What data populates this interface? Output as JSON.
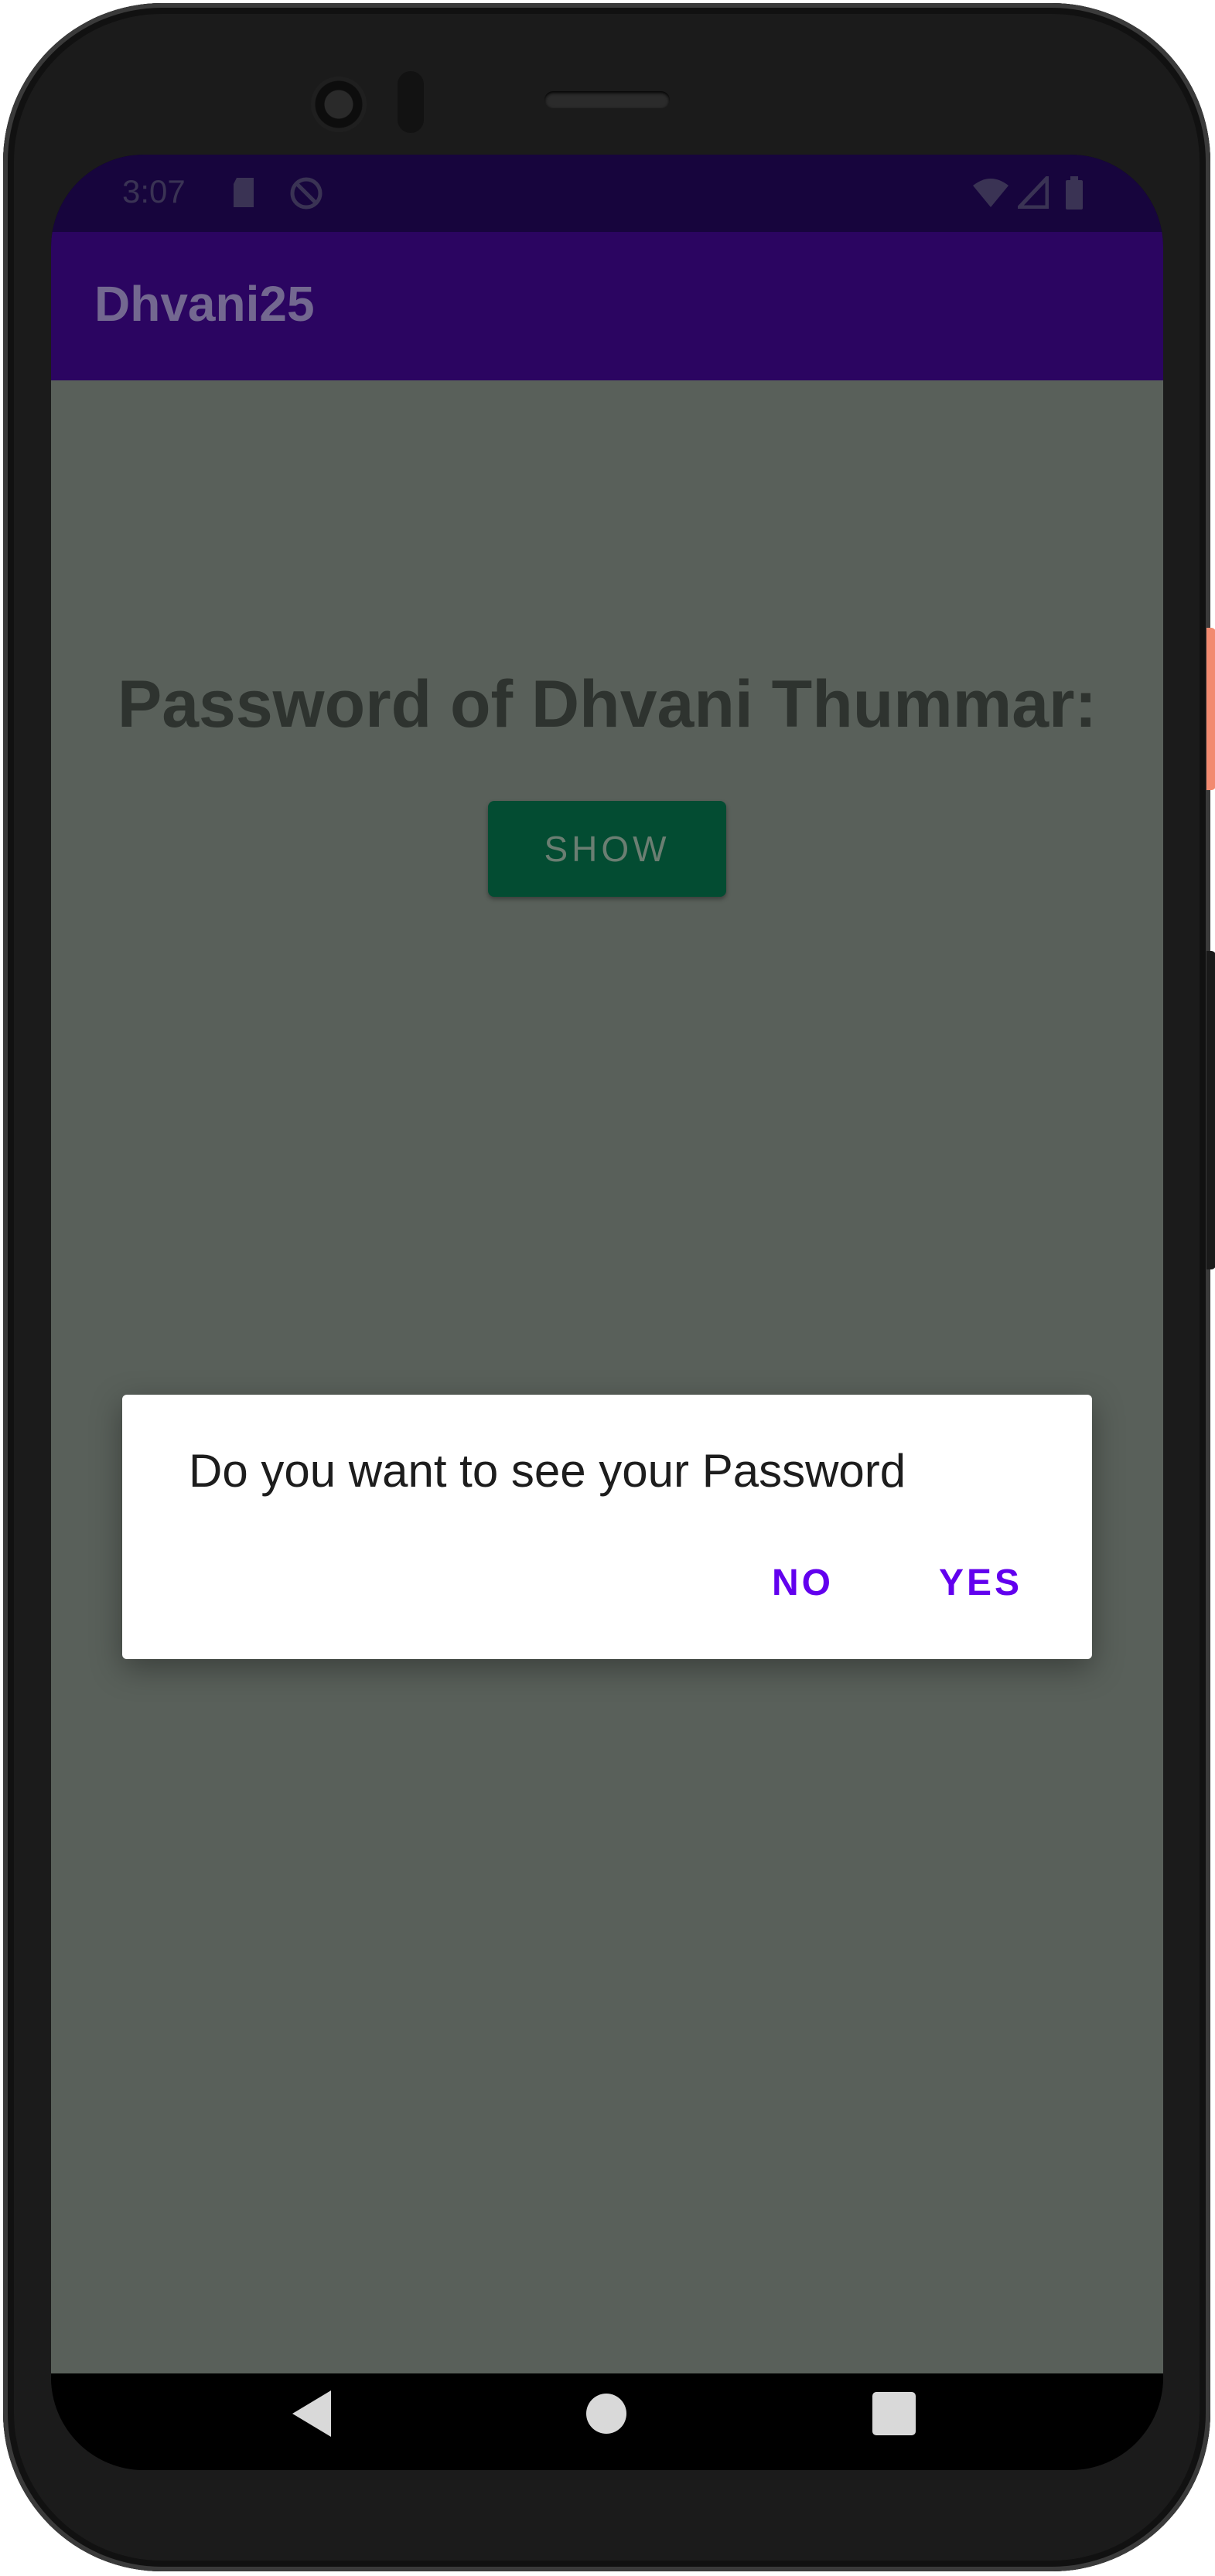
{
  "status_bar": {
    "time": "3:07",
    "icons": [
      "sd-card-icon",
      "do-not-disturb-icon",
      "wifi-icon",
      "cell-signal-icon",
      "battery-icon"
    ]
  },
  "app_bar": {
    "title": "Dhvani25"
  },
  "main": {
    "heading": "Password of Dhvani Thummar:",
    "show_button_label": "SHOW"
  },
  "dialog": {
    "message": "Do you want to see your Password",
    "no_label": "NO",
    "yes_label": "YES"
  },
  "nav_bar": {
    "icons": [
      "back-icon",
      "home-icon",
      "recents-icon"
    ]
  },
  "colors": {
    "status_bar": "#17053d",
    "app_bar": "#2b0561",
    "content_scrim": "#59605a",
    "show_button": "#034c32",
    "dialog_accent": "#6200ee"
  }
}
